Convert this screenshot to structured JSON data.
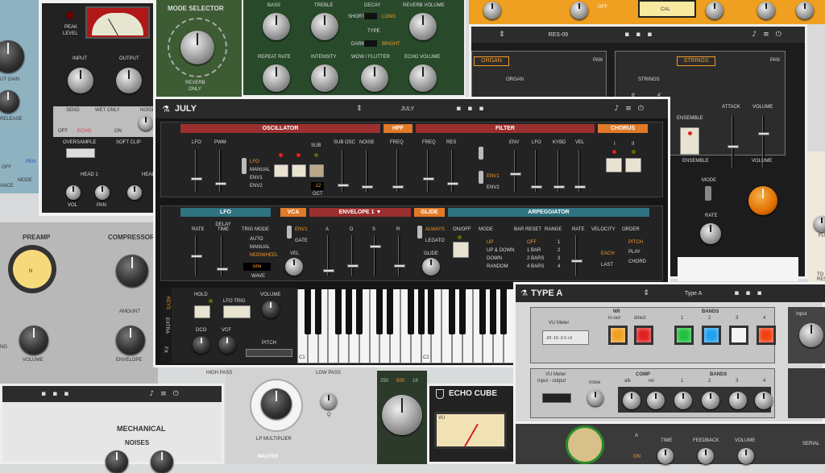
{
  "july": {
    "title": "JULY",
    "preset": "JULY",
    "sections": {
      "oscillator": "OSCILLATOR",
      "hpf": "HPF",
      "filter": "FILTER",
      "chorus": "CHORUS",
      "lfo": "LFO",
      "vca": "VCA",
      "envelope": "ENVELOPE 1 ▼",
      "glide": "GLIDE",
      "arpeggiator": "ARPEGGIATOR"
    },
    "osc": {
      "lfo": "LFO",
      "pwm": "PWM",
      "sub": "SUB",
      "sub_osc": "SUB OSC",
      "noise": "NOISE",
      "sources": [
        "LFO",
        "MANUAL",
        "ENV1",
        "ENV2"
      ],
      "oct_value": "-12",
      "oct": "OCT"
    },
    "hpf_freq": "FREQ",
    "filter": {
      "freq": "FREQ",
      "res": "RES",
      "env": "ENV",
      "lfo": "LFO",
      "kybd": "KYBD",
      "vel": "VEL",
      "env1": "ENV1",
      "env2": "ENV2"
    },
    "chorus": {
      "i": "I",
      "ii": "II"
    },
    "lfo": {
      "rate": "RATE",
      "delay": "DELAY TIME",
      "trig": "TRIG MODE",
      "modes": [
        "AUTO",
        "MANUAL",
        "MODWHEEL"
      ],
      "wave_value": "sine",
      "wave": "WAVE"
    },
    "vca": {
      "env1": "ENV1",
      "gate": "GATE",
      "vel": "VEL"
    },
    "env": {
      "a": "A",
      "d": "D",
      "s": "S",
      "r": "R"
    },
    "glide": {
      "always": "ALWAYS",
      "legato": "LEGATO",
      "glide": "GLIDE"
    },
    "arp": {
      "onoff": "ON/OFF",
      "mode": "MODE",
      "modes": [
        "UP",
        "UP & DOWN",
        "DOWN",
        "RANDOM"
      ],
      "bar_reset": "BAR RESET",
      "bar_opts": [
        "OFF",
        "1 BAR",
        "2 BARS",
        "4 BARS"
      ],
      "range": "RANGE",
      "range_opts": [
        "1",
        "2",
        "3",
        "4"
      ],
      "rate": "RATE",
      "velocity": "VELOCITY",
      "vel_opts": [
        "EACH",
        "LAST"
      ],
      "order": "ORDER",
      "order_opts": [
        "PITCH",
        "PLAY",
        "CHORD"
      ]
    },
    "perf": {
      "tabs": [
        "KEYS",
        "EXTRA",
        "FX"
      ],
      "hold": "HOLD",
      "lfo_trig": "LFO TRIG",
      "volume": "VOLUME",
      "dco": "DCO",
      "vcf": "VCF",
      "pitch": "PITCH",
      "c1": "C1",
      "c2": "C2"
    }
  },
  "res09": {
    "preset": "RES-09",
    "organ": "ORGAN",
    "strings": "STRINGS",
    "pan": "PAN",
    "organ_sub": "ORGAN",
    "strings_sub": "STRINGS",
    "volume": "VOLUME",
    "ensemble": "ENSEMBLE",
    "attack": "ATTACK",
    "ens_sect": "ENSEMBLE",
    "vol_sect": "VOLUME",
    "mode": "MODE",
    "rate": "RATE",
    "eight": "8'",
    "four": "4'",
    "sixteen": "16'"
  },
  "typeA": {
    "title": "TYPE A",
    "preset": "Type A",
    "vu_label": "VU Meter",
    "vu_scale": "-20 -10 -3 0 +3",
    "nr": "NR",
    "inout": "in-out",
    "direct": "direct",
    "bands": "BANDS",
    "band_nums": [
      "1",
      "2",
      "3",
      "4"
    ],
    "band_colors": [
      "#f0a020",
      "#e02020",
      "#20c040",
      "#20a0f0",
      "#f4f4f4",
      "#f04010"
    ],
    "vu2": "VU Meter",
    "vu2_sub": "input - output",
    "noise": "noise",
    "comp": "COMP",
    "atk": "atk",
    "rel": "rel",
    "bands2": "BANDS",
    "input": "Input"
  },
  "delay": {
    "mode_selector": "MODE SELECTOR",
    "reverb": "REVERB",
    "only": "ONLY",
    "bass": "BASS",
    "treble": "TREBLE",
    "decay": "DECAY",
    "short": "SHORT",
    "long": "LONG",
    "type": "TYPE",
    "dark": "DARK",
    "bright": "BRIGHT",
    "reverb_volume": "REVERB VOLUME",
    "repeat_rate": "REPEAT RATE",
    "intensity": "INTENSITY",
    "wow": "WOW / FLUTTER",
    "echo_volume": "ECHO VOLUME",
    "peak": "PEAK",
    "level": "LEVEL",
    "input": "INPUT",
    "output": "OUTPUT",
    "send": "SEND",
    "wet_only": "WET ONLY",
    "noise": "NOISE",
    "off": "OFF",
    "echo": "ECHO",
    "on": "ON",
    "oversample": "OVERSAMPLE",
    "soft_clip": "SOFT CLIP",
    "head1": "HEAD 1",
    "head": "HEAD",
    "vol": "VOL",
    "pan": "PAN",
    "mode_short": "MODE",
    "gain": "UT GAIN",
    "release": "RELEASE",
    "ance": "ANCE",
    "off2": "OFF",
    "pen": "PEN"
  },
  "comp": {
    "preamp": "PREAMP",
    "compressor": "COMPRESSOR",
    "amount": "AMOUNT",
    "volume": "VOLUME",
    "envelope": "ENVELOPE",
    "ng": "NG",
    "n": "N"
  },
  "mech": {
    "mechanical": "MECHANICAL",
    "noises": "NOISES"
  },
  "lpm": {
    "high_pass": "HIGH PASS",
    "low_pass": "LOW PASS",
    "lp_mult": "LP MULTIPLIER",
    "master": "MASTER",
    "q": "Q",
    "off": "OFF",
    "on": "ON"
  },
  "echo_cube": {
    "title": "ECHO CUBE",
    "vu": "VU",
    "scale": [
      "250",
      "500",
      "1K"
    ],
    "time": "TIME",
    "feedback": "FEEDBACK",
    "volume": "VOLUME",
    "a": "A",
    "on": "ON",
    "serial": "SERIAL"
  },
  "topright": {
    "off": "OFF",
    "cal": "CAL"
  },
  "rightedge": {
    "fu": "FU",
    "to_res": "TO RES"
  },
  "leftmid": {
    "ng": "NG"
  }
}
